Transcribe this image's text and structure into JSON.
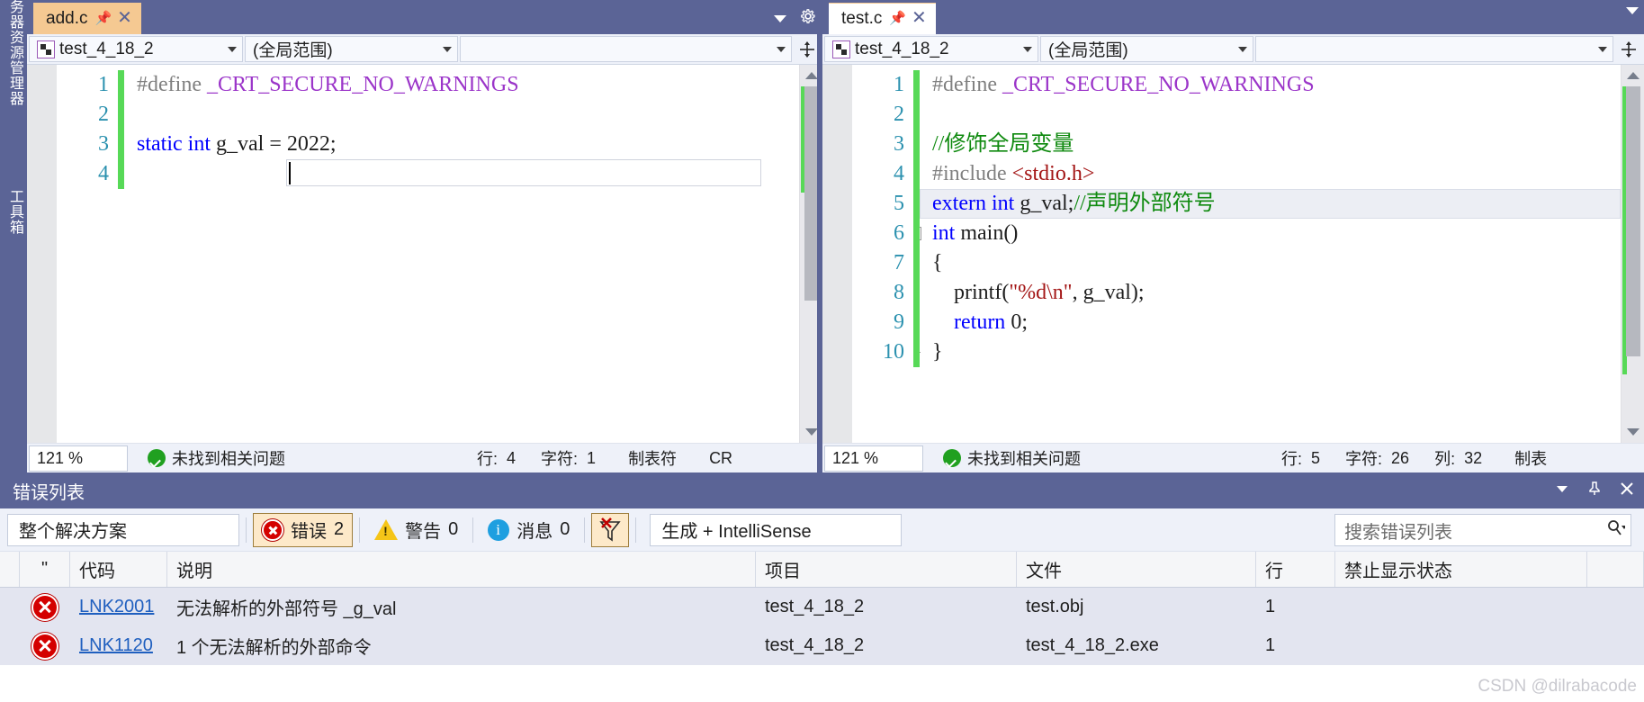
{
  "dock": {
    "server_explorer": "服务器资源管理器",
    "toolbox": "工具箱"
  },
  "left_pane": {
    "tab": {
      "title": "add.c",
      "pin_icon": "pin-icon",
      "close_icon": "close-icon"
    },
    "tabstrip": {
      "dropdown_icon": "chevron-down-icon",
      "settings_icon": "gear-icon"
    },
    "navbar": {
      "project": "test_4_18_2",
      "scope": "(全局范围)",
      "member": "",
      "split_icon": "split-window-icon"
    },
    "code": {
      "lines": [
        {
          "num": "1",
          "text": "#define _CRT_SECURE_NO_WARNINGS"
        },
        {
          "num": "2",
          "text": ""
        },
        {
          "num": "3",
          "text": "static int g_val = 2022;"
        },
        {
          "num": "4",
          "text": ""
        }
      ]
    },
    "status": {
      "zoom": "121 %",
      "problems": "未找到相关问题",
      "line_label": "行:",
      "line_value": "4",
      "char_label": "字符:",
      "char_value": "1",
      "tabs_label": "制表符",
      "eol_label": "CR"
    }
  },
  "right_pane": {
    "tab": {
      "title": "test.c",
      "pin_icon": "pin-icon",
      "close_icon": "close-icon"
    },
    "tabstrip": {
      "dropdown_icon": "chevron-down-icon"
    },
    "navbar": {
      "project": "test_4_18_2",
      "scope": "(全局范围)",
      "member": "",
      "split_icon": "split-window-icon"
    },
    "code": {
      "lines": [
        {
          "num": "1",
          "text": "#define _CRT_SECURE_NO_WARNINGS"
        },
        {
          "num": "2",
          "text": ""
        },
        {
          "num": "3",
          "text": "//修饰全局变量"
        },
        {
          "num": "4",
          "text": "#include <stdio.h>"
        },
        {
          "num": "5",
          "text": "extern int g_val;//声明外部符号"
        },
        {
          "num": "6",
          "text": "int main()"
        },
        {
          "num": "7",
          "text": "{"
        },
        {
          "num": "8",
          "text": "    printf(\"%d\\n\", g_val);"
        },
        {
          "num": "9",
          "text": "    return 0;"
        },
        {
          "num": "10",
          "text": "}"
        }
      ]
    },
    "status": {
      "zoom": "121 %",
      "problems": "未找到相关问题",
      "line_label": "行:",
      "line_value": "5",
      "char_label": "字符:",
      "char_value": "26",
      "col_label": "列:",
      "col_value": "32",
      "tabs_label": "制表"
    }
  },
  "error_list": {
    "title": "错误列表",
    "header_buttons": {
      "dropdown": "chevron-down-icon",
      "pin": "pin-icon",
      "close": "close-icon"
    },
    "toolbar": {
      "scope": "整个解决方案",
      "errors_label": "错误",
      "errors_count": "2",
      "warnings_label": "警告",
      "warnings_count": "0",
      "messages_label": "消息",
      "messages_count": "0",
      "clear_filter_icon": "clear-filter-icon",
      "build_filter": "生成 + IntelliSense",
      "search_placeholder": "搜索错误列表",
      "search_value": "",
      "search_icon": "search-icon"
    },
    "columns": [
      {
        "key": "sel",
        "label": ""
      },
      {
        "key": "icon",
        "label": "\""
      },
      {
        "key": "code",
        "label": "代码"
      },
      {
        "key": "desc",
        "label": "说明"
      },
      {
        "key": "proj",
        "label": "项目"
      },
      {
        "key": "file",
        "label": "文件"
      },
      {
        "key": "line",
        "label": "行"
      },
      {
        "key": "supp",
        "label": "禁止显示状态"
      }
    ],
    "rows": [
      {
        "icon": "error-icon",
        "code": "LNK2001",
        "desc": "无法解析的外部符号 _g_val",
        "project": "test_4_18_2",
        "file": "test.obj",
        "line": "1",
        "suppression": ""
      },
      {
        "icon": "error-icon",
        "code": "LNK1120",
        "desc": "1 个无法解析的外部命令",
        "project": "test_4_18_2",
        "file": "test_4_18_2.exe",
        "line": "1",
        "suppression": ""
      }
    ],
    "watermark": "CSDN @dilrabacode"
  },
  "colors": {
    "chrome_blue": "#5b6496",
    "active_tab": "#f5c992",
    "error_red": "#d40000",
    "ok_green": "#20a020",
    "link_blue": "#1f5fbf",
    "changebar_green": "#57d957"
  }
}
